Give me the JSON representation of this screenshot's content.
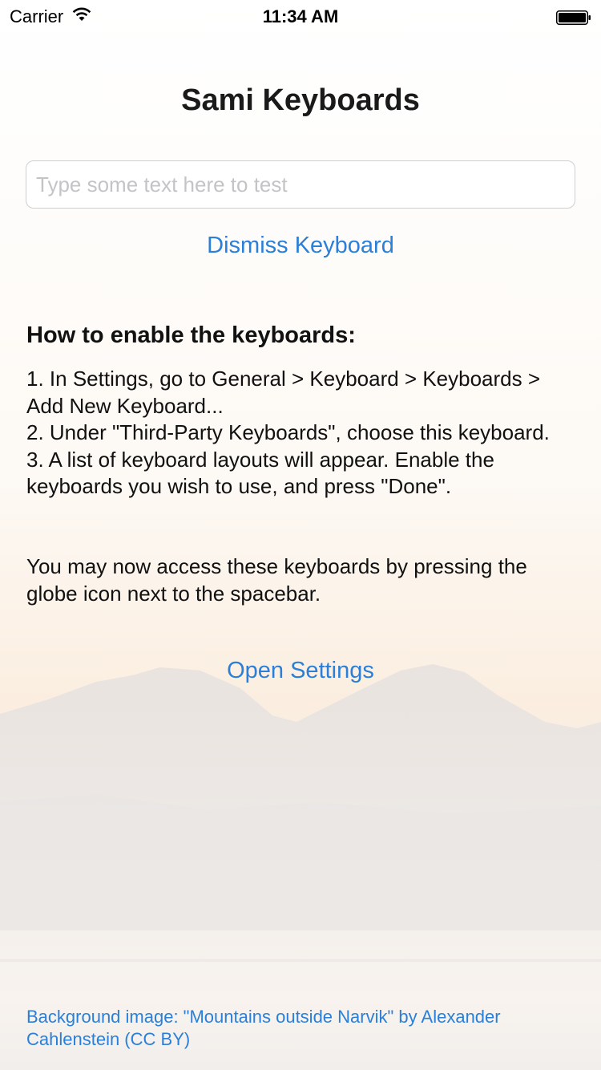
{
  "status_bar": {
    "carrier": "Carrier",
    "time": "11:34 AM"
  },
  "title": "Sami Keyboards",
  "test_input": {
    "placeholder": "Type some text here to test",
    "value": ""
  },
  "dismiss_keyboard_label": "Dismiss Keyboard",
  "instructions": {
    "heading": "How to enable the keyboards:",
    "steps": [
      "1. In Settings, go to General > Keyboard > Keyboards > Add New Keyboard...",
      "2. Under \"Third-Party Keyboards\", choose this keyboard.",
      "3. A list of keyboard layouts will appear. Enable the keyboards you wish to use, and press \"Done\"."
    ],
    "globe_note": "You may now access these keyboards by pressing the globe icon next to the spacebar."
  },
  "open_settings_label": "Open Settings",
  "credit_text": "Background image: \"Mountains outside Narvik\" by Alexander Cahlenstein (CC BY)",
  "colors": {
    "accent": "#2a7fd8",
    "background": "#fbf9f7"
  },
  "icons": {
    "wifi": "wifi-icon",
    "battery": "battery-icon"
  }
}
